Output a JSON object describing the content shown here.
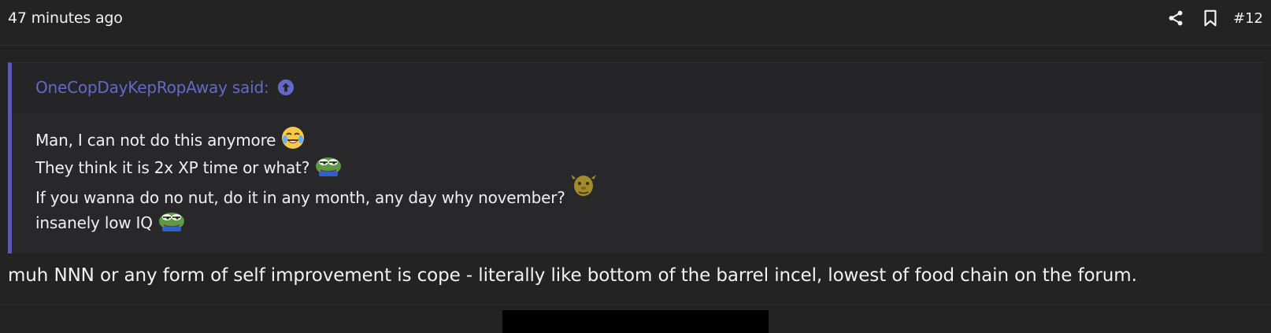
{
  "post": {
    "time": "47 minutes ago",
    "number": "#12",
    "actions": {
      "share_icon": "share-icon",
      "bookmark_icon": "bookmark-icon"
    }
  },
  "quote": {
    "author_line": "OneCopDayKepRopAway said:",
    "goto_icon": "arrow-up-circle-icon",
    "lines": [
      {
        "text": "Man, I can not do this anymore",
        "emoji": "joy-tears-emoji"
      },
      {
        "text": "They think it is 2x XP time or what?",
        "emoji": "pepe-emoji"
      },
      {
        "text": "If you wanna do no nut, do it in any month, any day why november?",
        "emoji": "shrek-emoji"
      },
      {
        "text": "insanely low IQ",
        "emoji": "pepe-emoji"
      }
    ]
  },
  "reply": {
    "text": "muh NNN or any form of self improvement is cope - literally like bottom of the barrel incel, lowest of food chain on the forum."
  },
  "colors": {
    "background": "#232324",
    "quote_accent": "#5a5ab0",
    "link": "#6468c8"
  }
}
